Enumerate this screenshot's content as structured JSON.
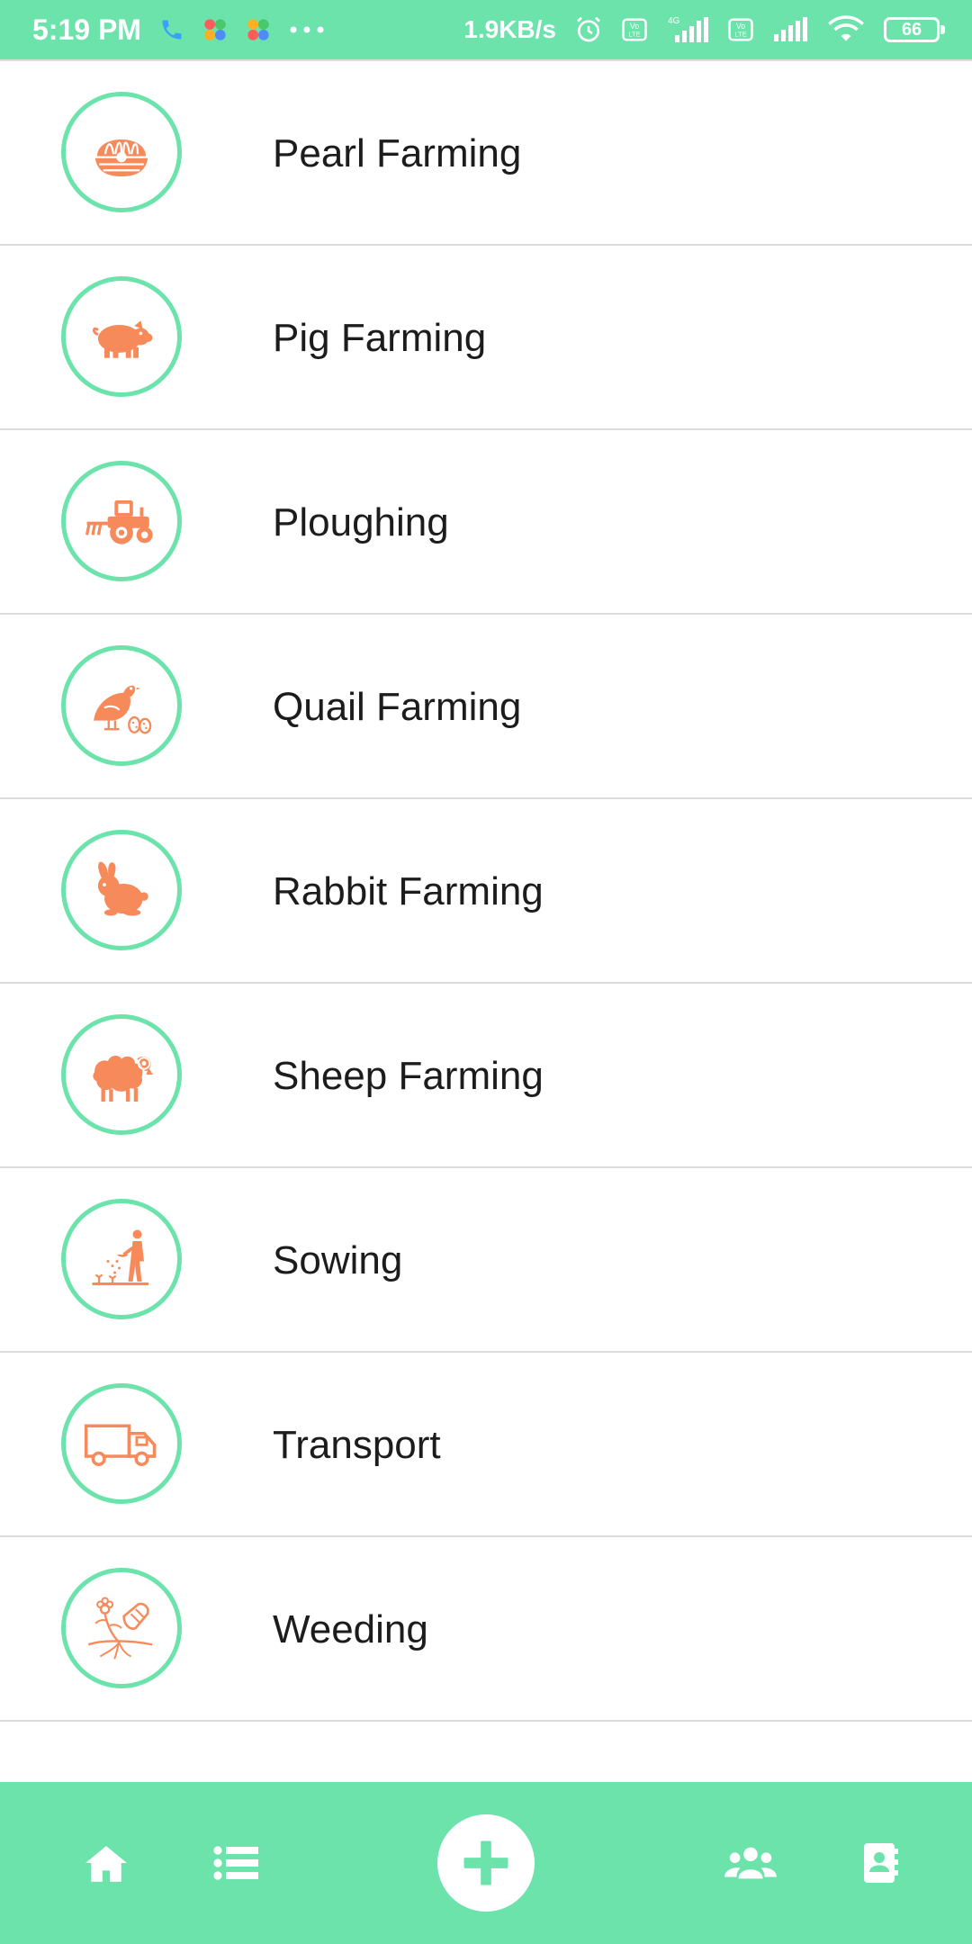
{
  "status_bar": {
    "time": "5:19 PM",
    "network_speed": "1.9KB/s",
    "network_type": "4G",
    "battery": "66",
    "icons": [
      "phone-icon",
      "app-icon",
      "app-icon",
      "more-icon",
      "alarm-icon",
      "volte-icon",
      "signal-icon",
      "volte-icon",
      "signal-icon",
      "wifi-icon",
      "battery-icon"
    ]
  },
  "list": {
    "items": [
      {
        "label": "",
        "icon": "partial-icon"
      },
      {
        "label": "Pearl Farming",
        "icon": "pearl-icon"
      },
      {
        "label": "Pig Farming",
        "icon": "pig-icon"
      },
      {
        "label": "Ploughing",
        "icon": "tractor-icon"
      },
      {
        "label": "Quail Farming",
        "icon": "quail-icon"
      },
      {
        "label": "Rabbit Farming",
        "icon": "rabbit-icon"
      },
      {
        "label": "Sheep Farming",
        "icon": "sheep-icon"
      },
      {
        "label": "Sowing",
        "icon": "sowing-icon"
      },
      {
        "label": "Transport",
        "icon": "truck-icon"
      },
      {
        "label": "Weeding",
        "icon": "weeding-icon"
      }
    ]
  },
  "bottom_nav": {
    "items": [
      "home-icon",
      "list-icon",
      "add-icon",
      "users-icon",
      "contacts-icon"
    ]
  },
  "colors": {
    "accent": "#6be3ab",
    "icon": "#f68a5b",
    "text": "#1c1c1c",
    "divider": "#dcdcdc"
  }
}
